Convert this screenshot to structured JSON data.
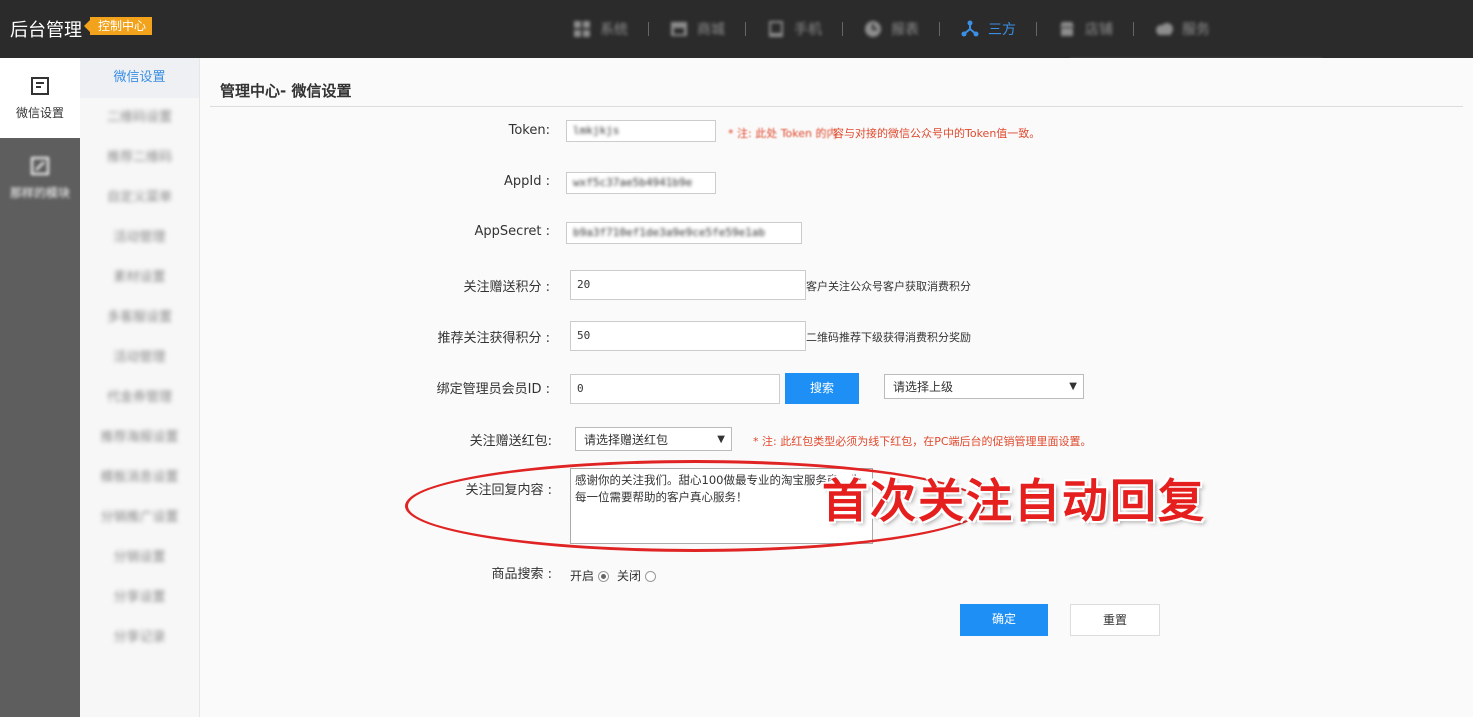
{
  "header": {
    "brand": "后台管理",
    "badge": "控制中心",
    "nav": [
      {
        "label": "系统",
        "icon": "grid-icon",
        "active": false
      },
      {
        "label": "商城",
        "icon": "store-icon",
        "active": false
      },
      {
        "label": "手机",
        "icon": "tablet-icon",
        "active": false
      },
      {
        "label": "报表",
        "icon": "clock-icon",
        "active": false
      },
      {
        "label": "三方",
        "icon": "network-icon",
        "active": true
      },
      {
        "label": "店铺",
        "icon": "shop-icon",
        "active": false
      },
      {
        "label": "服务",
        "icon": "cloud-icon",
        "active": false
      }
    ]
  },
  "iconbar": {
    "items": [
      {
        "label": "微信设置",
        "icon": "wechat-settings-icon",
        "active": true
      },
      {
        "label": "那样的模块",
        "icon": "edit-icon",
        "active": false
      }
    ]
  },
  "submenu": {
    "items": [
      "微信设置",
      "二维码设置",
      "推荐二维码",
      "自定义菜单",
      "活动管理",
      "素材设置",
      "多客服设置",
      "活动管理",
      "代金券管理",
      "推荐海报设置",
      "模板消息设置",
      "分销推广设置",
      "分销设置",
      "分享设置",
      "分享记录"
    ]
  },
  "main": {
    "title": "管理中心- 微信设置",
    "token": {
      "label": "Token:",
      "value": "lmkjkjs",
      "hint_red": "* 注: 此处 Token 的内",
      "hint": "容与对接的微信公众号中的Token值一致。"
    },
    "appid": {
      "label": "AppId :",
      "value": "wxf5c37ae5b4941b9e"
    },
    "appsecret": {
      "label": "AppSecret :",
      "value": "b9a3f710ef1de3a9e9ce5fe59e1ab"
    },
    "follow_points": {
      "label": "关注赠送积分 :",
      "value": "20",
      "hint": "客户关注公众号客户获取消费积分"
    },
    "recommend_points": {
      "label": "推荐关注获得积分 :",
      "value": "50",
      "hint": "二维码推荐下级获得消费积分奖励"
    },
    "admin_id": {
      "label": "绑定管理员会员ID :",
      "value": "0",
      "search_button": "搜索",
      "select": "请选择上级"
    },
    "redpacket": {
      "label": "关注赠送红包:",
      "select": "请选择赠送红包",
      "hint": "* 注: 此红包类型必须为线下红包，在PC端后台的促销管理里面设置。"
    },
    "reply": {
      "label": "关注回复内容 :",
      "value": "感谢你的关注我们。甜心100做最专业的淘宝服务商，为每一位需要帮助的客户真心服务！"
    },
    "product_search": {
      "label": "商品搜索 :",
      "on": "开启",
      "off": "关闭",
      "selected": "开启"
    },
    "submit": "确定",
    "reset": "重置"
  },
  "annotation": "首次关注自动回复",
  "colors": {
    "accent": "#1e90f5",
    "annotation": "#e51e1e",
    "topbar": "#2b2b2b",
    "badge": "#f3a21c"
  }
}
